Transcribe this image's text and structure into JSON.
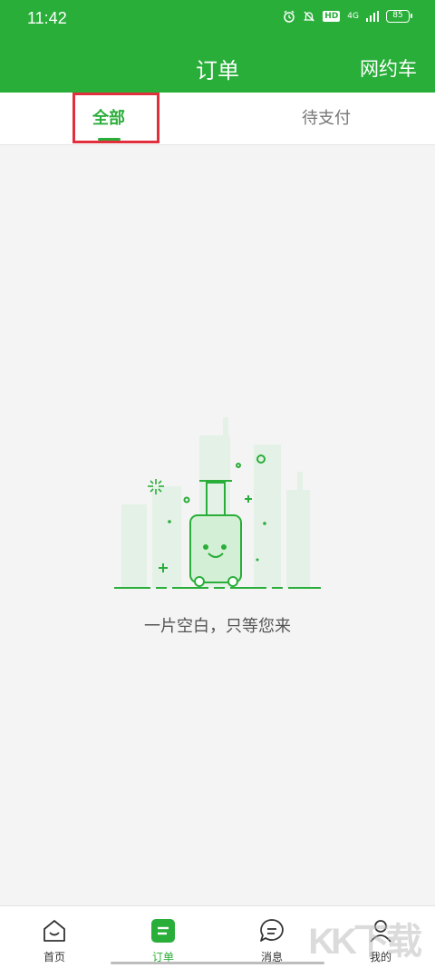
{
  "status_bar": {
    "time": "11:42",
    "network": "4G",
    "hd": "HD",
    "battery": "85"
  },
  "header": {
    "title": "订单",
    "right_link": "网约车"
  },
  "tabs": [
    {
      "label": "全部"
    },
    {
      "label": "待支付"
    }
  ],
  "empty_state": {
    "message": "一片空白，只等您来"
  },
  "bottom_nav": [
    {
      "label": "首页",
      "icon": "home-icon"
    },
    {
      "label": "订单",
      "icon": "order-icon"
    },
    {
      "label": "消息",
      "icon": "message-icon"
    },
    {
      "label": "我的",
      "icon": "profile-icon"
    }
  ],
  "watermark": "KK下载",
  "colors": {
    "brand": "#2aae3a",
    "highlight": "#e0303e"
  }
}
